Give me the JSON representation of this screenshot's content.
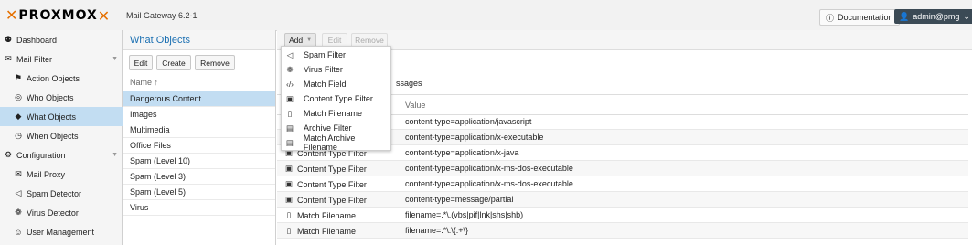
{
  "header": {
    "logo_text": "PROXMOX",
    "product": "Mail Gateway 6.2-1",
    "doc_label": "Documentation",
    "user_label": "admin@pmg"
  },
  "nav": [
    {
      "label": "Dashboard",
      "icon": "dashboard-icon",
      "glyph": "⚉"
    },
    {
      "label": "Mail Filter",
      "icon": "envelope-icon",
      "glyph": "✉"
    },
    {
      "label": "Action Objects",
      "icon": "flag-icon",
      "glyph": "⚑"
    },
    {
      "label": "Who Objects",
      "icon": "user-circle-icon",
      "glyph": "◎"
    },
    {
      "label": "What Objects",
      "icon": "cube-icon",
      "glyph": "◆"
    },
    {
      "label": "When Objects",
      "icon": "clock-icon",
      "glyph": "◷"
    },
    {
      "label": "Configuration",
      "icon": "cogs-icon",
      "glyph": "⚙"
    },
    {
      "label": "Mail Proxy",
      "icon": "envelope-outline-icon",
      "glyph": "✉"
    },
    {
      "label": "Spam Detector",
      "icon": "bullhorn-icon",
      "glyph": "◁"
    },
    {
      "label": "Virus Detector",
      "icon": "bug-icon",
      "glyph": "❁"
    },
    {
      "label": "User Management",
      "icon": "users-icon",
      "glyph": "☺"
    }
  ],
  "objects_panel": {
    "title": "What Objects",
    "edit": "Edit",
    "create": "Create",
    "remove": "Remove",
    "column": "Name ↑",
    "items": [
      "Dangerous Content",
      "Images",
      "Multimedia",
      "Office Files",
      "Spam (Level 10)",
      "Spam (Level 3)",
      "Spam (Level 5)",
      "Virus"
    ]
  },
  "main": {
    "add": "Add",
    "edit": "Edit",
    "remove": "Remove",
    "info_text": "ssages",
    "value_header": "Value",
    "rows": [
      {
        "type": "",
        "value": "content-type=application/javascript"
      },
      {
        "type": "",
        "value": "content-type=application/x-executable"
      },
      {
        "type": "Content Type Filter",
        "value": "content-type=application/x-java"
      },
      {
        "type": "Content Type Filter",
        "value": "content-type=application/x-ms-dos-executable"
      },
      {
        "type": "Content Type Filter",
        "value": "content-type=application/x-ms-dos-executable"
      },
      {
        "type": "Content Type Filter",
        "value": "content-type=message/partial"
      },
      {
        "type": "Match Filename",
        "value": "filename=.*\\.(vbs|pif|lnk|shs|shb)"
      },
      {
        "type": "Match Filename",
        "value": "filename=.*\\.\\{.+\\}"
      }
    ]
  },
  "add_menu": [
    {
      "label": "Spam Filter",
      "icon": "bullhorn-icon",
      "glyph": "◁"
    },
    {
      "label": "Virus Filter",
      "icon": "bug-icon",
      "glyph": "❁"
    },
    {
      "label": "Match Field",
      "icon": "code-icon",
      "glyph": "‹/›"
    },
    {
      "label": "Content Type Filter",
      "icon": "image-file-icon",
      "glyph": "▣"
    },
    {
      "label": "Match Filename",
      "icon": "file-icon",
      "glyph": "▯"
    },
    {
      "label": "Archive Filter",
      "icon": "archive-file-icon",
      "glyph": "▤"
    },
    {
      "label": "Match Archive Filename",
      "icon": "archive-file-icon",
      "glyph": "▤"
    }
  ]
}
